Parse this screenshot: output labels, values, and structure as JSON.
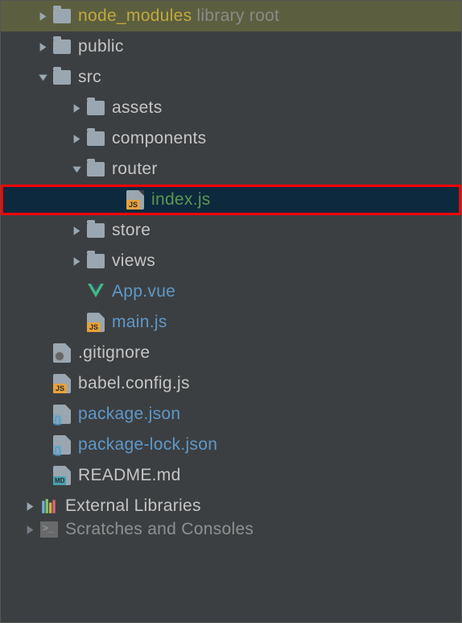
{
  "tree": {
    "node_modules": {
      "label": "node_modules",
      "suffix": "library root"
    },
    "public": {
      "label": "public"
    },
    "src": {
      "label": "src",
      "children": {
        "assets": {
          "label": "assets"
        },
        "components": {
          "label": "components"
        },
        "router": {
          "label": "router",
          "children": {
            "index": {
              "label": "index.js"
            }
          }
        },
        "store": {
          "label": "store"
        },
        "views": {
          "label": "views"
        },
        "app_vue": {
          "label": "App.vue"
        },
        "main_js": {
          "label": "main.js"
        }
      }
    },
    "gitignore": {
      "label": ".gitignore"
    },
    "babel": {
      "label": "babel.config.js"
    },
    "package": {
      "label": "package.json"
    },
    "package_lock": {
      "label": "package-lock.json"
    },
    "readme": {
      "label": "README.md"
    },
    "external_libs": {
      "label": "External Libraries"
    },
    "scratches": {
      "label": "Scratches and Consoles"
    }
  }
}
